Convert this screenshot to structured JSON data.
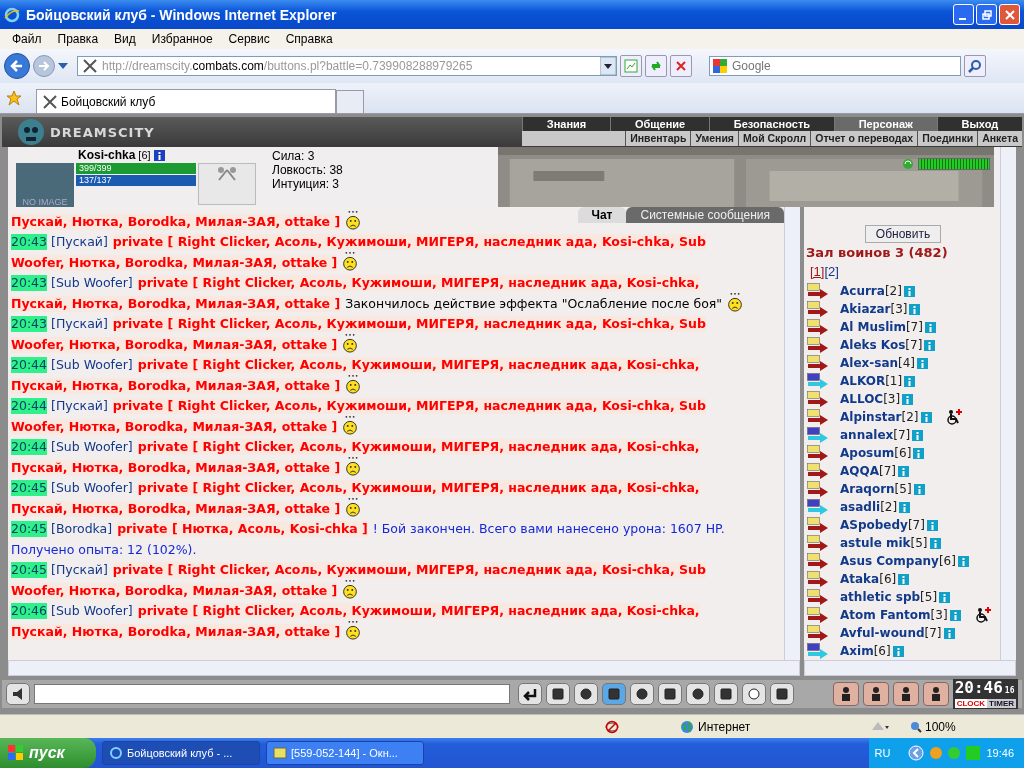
{
  "window": {
    "title": "Бойцовский клуб - Windows Internet Explorer"
  },
  "menu": [
    "Файл",
    "Правка",
    "Вид",
    "Избранное",
    "Сервис",
    "Справка"
  ],
  "address": {
    "scheme": "http://dreamscity.",
    "host": "combats.com",
    "path": "/buttons.pl?battle=0.739908288979265"
  },
  "search": {
    "placeholder": "Google"
  },
  "tabs": [
    {
      "label": "Бойцовский клуб",
      "selected": true
    }
  ],
  "game": {
    "logo": "DREAMSCITY",
    "nav_top": [
      {
        "label": "Знания",
        "selected": false
      },
      {
        "label": "Общение",
        "selected": false
      },
      {
        "label": "Безопасность",
        "selected": false
      },
      {
        "label": "Персонаж",
        "selected": true
      },
      {
        "label": "Выход",
        "selected": false
      }
    ],
    "nav_sub": [
      "Инвентарь",
      "Умения",
      "Мой Скролл",
      "Отчет о переводах",
      "Поединки",
      "Анкета"
    ],
    "character": {
      "name": "Kosi-chka",
      "level": "[6]",
      "avatar": "NO IMAGE",
      "hp": {
        "reading": "399/399",
        "level": 1
      },
      "mana": {
        "reading": "137/137",
        "level": 1
      },
      "stats": [
        "Сила: 3",
        "Ловкость: 38",
        "Интуиция: 3"
      ],
      "energy": {
        "level": 1
      }
    },
    "chat_tabs": [
      {
        "label": "Чат",
        "selected": true
      },
      {
        "label": "Системные сообщения",
        "selected": false
      }
    ],
    "messages": [
      {
        "lines": [
          [
            {
              "kind": "private",
              "text": "Пускай, Нютка, Borodka, Милая-ЗАЯ, ottake ]"
            }
          ]
        ],
        "smiley": true
      },
      {
        "time": "20:43",
        "sender": "[Пускай]",
        "lines": [
          [
            {
              "kind": "private",
              "text": "private [ Right Clicker, Асоль, Кужимоши, МИГЕРЯ, наследник ада, Kosi-chka, Sub"
            }
          ],
          [
            {
              "kind": "private",
              "text": "Woofer, Нютка, Borodka, Милая-ЗАЯ, ottake ]"
            }
          ]
        ],
        "smiley": true
      },
      {
        "time": "20:43",
        "sender": "[Sub Woofer]",
        "lines": [
          [
            {
              "kind": "private",
              "text": "private [ Right Clicker, Асоль, Кужимоши, МИГЕРЯ, наследник ада, Kosi-chka,"
            }
          ],
          [
            {
              "kind": "private",
              "text": "Пускай, Нютка, Borodka, Милая-ЗАЯ, ottake ]"
            },
            {
              "kind": "effect",
              "text": "Закончилось действие эффекта \"Ослабление после боя\""
            }
          ]
        ],
        "smiley": true
      },
      {
        "time": "20:43",
        "sender": "[Пускай]",
        "lines": [
          [
            {
              "kind": "private",
              "text": "private [ Right Clicker, Асоль, Кужимоши, МИГЕРЯ, наследник ада, Kosi-chka, Sub"
            }
          ],
          [
            {
              "kind": "private",
              "text": "Woofer, Нютка, Borodka, Милая-ЗАЯ, ottake ]"
            }
          ]
        ],
        "smiley": true
      },
      {
        "time": "20:44",
        "sender": "[Sub Woofer]",
        "lines": [
          [
            {
              "kind": "private",
              "text": "private [ Right Clicker, Асоль, Кужимоши, МИГЕРЯ, наследник ада, Kosi-chka,"
            }
          ],
          [
            {
              "kind": "private",
              "text": "Пускай, Нютка, Borodka, Милая-ЗАЯ, ottake ]"
            }
          ]
        ],
        "smiley": true
      },
      {
        "time": "20:44",
        "sender": "[Пускай]",
        "lines": [
          [
            {
              "kind": "private",
              "text": "private [ Right Clicker, Асоль, Кужимоши, МИГЕРЯ, наследник ада, Kosi-chka, Sub"
            }
          ],
          [
            {
              "kind": "private",
              "text": "Woofer, Нютка, Borodka, Милая-ЗАЯ, ottake ]"
            }
          ]
        ],
        "smiley": true
      },
      {
        "time": "20:44",
        "sender": "[Sub Woofer]",
        "lines": [
          [
            {
              "kind": "private",
              "text": "private [ Right Clicker, Асоль, Кужимоши, МИГЕРЯ, наследник ада, Kosi-chka,"
            }
          ],
          [
            {
              "kind": "private",
              "text": "Пускай, Нютка, Borodka, Милая-ЗАЯ, ottake ]"
            }
          ]
        ],
        "smiley": true
      },
      {
        "time": "20:45",
        "sender": "[Sub Woofer]",
        "lines": [
          [
            {
              "kind": "private",
              "text": "private [ Right Clicker, Асоль, Кужимоши, МИГЕРЯ, наследник ада, Kosi-chka,"
            }
          ],
          [
            {
              "kind": "private",
              "text": "Пускай, Нютка, Borodka, Милая-ЗАЯ, ottake ]"
            }
          ]
        ],
        "smiley": true
      },
      {
        "time": "20:45",
        "sender": "[Borodka]",
        "lines": [
          [
            {
              "kind": "private",
              "text": "private [ Нютка, Асоль, Kosi-chka ]"
            },
            {
              "kind": "system",
              "text": "! Бой закончен. Всего вами нанесено урона: 1607 HP."
            }
          ],
          [
            {
              "kind": "system",
              "text": "Получено опыта: 12 (102%)."
            }
          ]
        ],
        "smiley": false
      },
      {
        "time": "20:45",
        "sender": "[Пускай]",
        "lines": [
          [
            {
              "kind": "private",
              "text": "private [ Right Clicker, Асоль, Кужимоши, МИГЕРЯ, наследник ада, Kosi-chka, Sub"
            }
          ],
          [
            {
              "kind": "private",
              "text": "Woofer, Нютка, Borodka, Милая-ЗАЯ, ottake ]"
            }
          ]
        ],
        "smiley": true
      },
      {
        "time": "20:46",
        "sender": "[Sub Woofer]",
        "lines": [
          [
            {
              "kind": "private",
              "text": "private [ Right Clicker, Асоль, Кужимоши, МИГЕРЯ, наследник ада, Kosi-chka,"
            }
          ],
          [
            {
              "kind": "private",
              "text": "Пускай, Нютка, Borodka, Милая-ЗАЯ, ottake ]"
            }
          ]
        ],
        "smiley": true
      }
    ],
    "room": {
      "refresh": "Обновить",
      "title": "Зал воинов 3 (482)",
      "pages": [
        {
          "label": "[1]",
          "selected": true
        },
        {
          "label": "[2]",
          "selected": false
        }
      ],
      "players": [
        {
          "name": "Acurra",
          "level": "[2]",
          "color": "#a01818",
          "injured": false
        },
        {
          "name": "Akiazar",
          "level": "[3]",
          "color": "#a01818",
          "injured": false
        },
        {
          "name": "Al Muslim",
          "level": "[7]",
          "color": "#a01818",
          "injured": false
        },
        {
          "name": "Aleks Kos",
          "level": "[7]",
          "color": "#a01818",
          "injured": false
        },
        {
          "name": "Alex-san",
          "level": "[4]",
          "color": "#a01818",
          "injured": false
        },
        {
          "name": "ALKOR",
          "level": "[1]",
          "color": "#30c8e0",
          "injured": false
        },
        {
          "name": "ALLOC",
          "level": "[3]",
          "color": "#a01818",
          "injured": false
        },
        {
          "name": "Alpinstar",
          "level": "[2]",
          "color": "#a01818",
          "injured": true
        },
        {
          "name": "annalex",
          "level": "[7]",
          "color": "#30c8e0",
          "injured": false
        },
        {
          "name": "Aposum",
          "level": "[6]",
          "color": "#a01818",
          "injured": false
        },
        {
          "name": "AQQA",
          "level": "[7]",
          "color": "#a01818",
          "injured": false
        },
        {
          "name": "Araqorn",
          "level": "[5]",
          "color": "#a01818",
          "injured": false
        },
        {
          "name": "asadli",
          "level": "[2]",
          "color": "#30c8e0",
          "injured": false
        },
        {
          "name": "ASpobedy",
          "level": "[7]",
          "color": "#a01818",
          "injured": false
        },
        {
          "name": "astule mik",
          "level": "[5]",
          "color": "#a01818",
          "injured": false
        },
        {
          "name": "Asus Company",
          "level": "[6]",
          "color": "#a01818",
          "injured": false
        },
        {
          "name": "Ataka",
          "level": "[6]",
          "color": "#a01818",
          "injured": false
        },
        {
          "name": "athletic spb",
          "level": "[5]",
          "color": "#a01818",
          "injured": false
        },
        {
          "name": "Atom Fantom",
          "level": "[3]",
          "color": "#a01818",
          "injured": true
        },
        {
          "name": "Avful-wound",
          "level": "[7]",
          "color": "#a01818",
          "injured": false
        },
        {
          "name": "Axim",
          "level": "[6]",
          "color": "#30c8e0",
          "injured": false
        }
      ]
    },
    "clock": {
      "time": "20:46",
      "seconds": "16",
      "clock_label": "CLOCK",
      "timer_label": "TIMER"
    }
  },
  "status_bar": {
    "zone": "Интернет",
    "zoom": "100%"
  },
  "taskbar": {
    "start": "пуск",
    "tasks": [
      {
        "label": "Бойцовский клуб - ...",
        "selected": true
      },
      {
        "label": "[559-052-144] - Окн...",
        "selected": false
      }
    ],
    "lang": "RU",
    "time": "19:46"
  }
}
